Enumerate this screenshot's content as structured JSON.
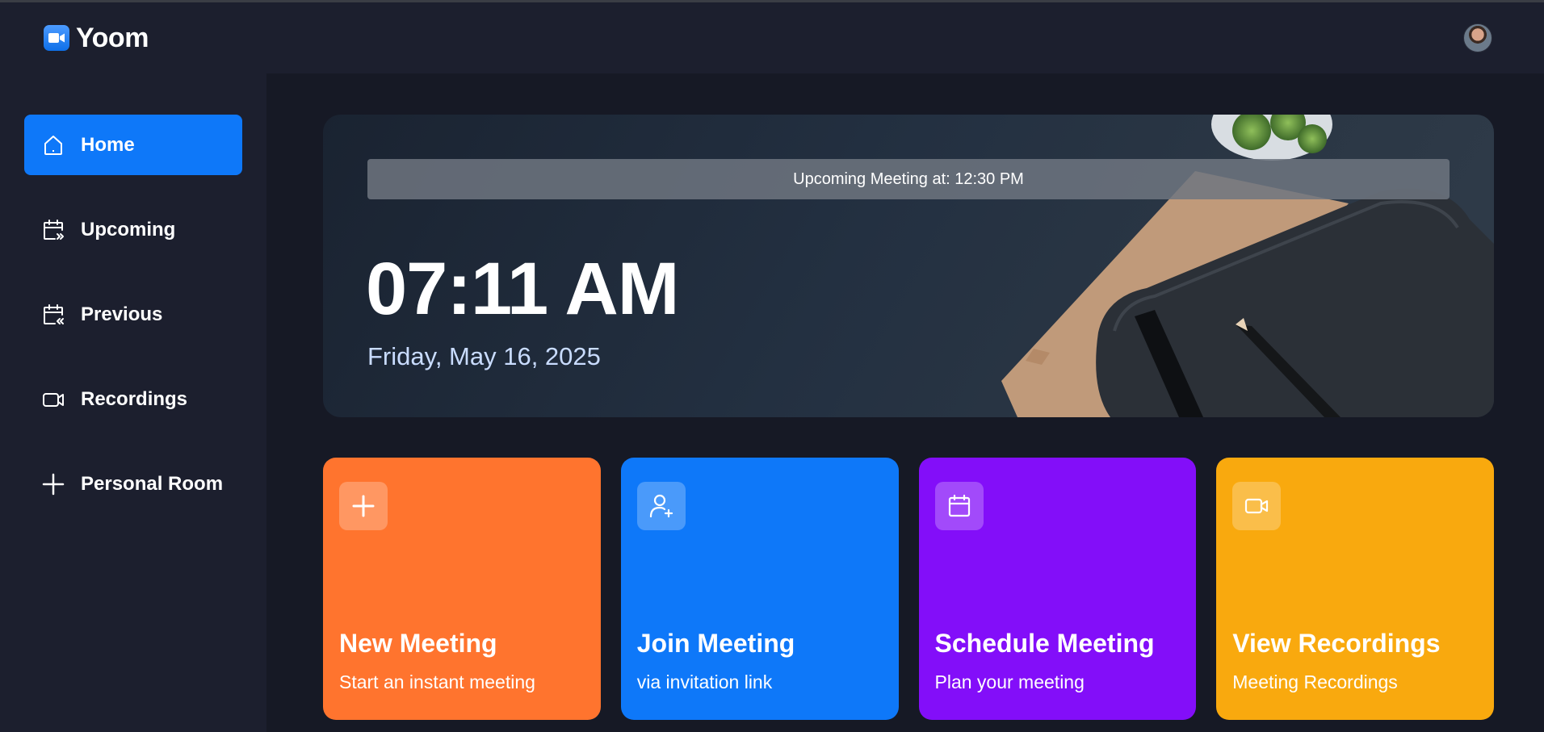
{
  "app": {
    "name": "Yoom",
    "logo_icon": "video-camera-icon",
    "avatar_icon": "user-avatar"
  },
  "sidebar": {
    "items": [
      {
        "label": "Home",
        "icon": "home-icon",
        "active": true
      },
      {
        "label": "Upcoming",
        "icon": "calendar-forward-icon",
        "active": false
      },
      {
        "label": "Previous",
        "icon": "calendar-back-icon",
        "active": false
      },
      {
        "label": "Recordings",
        "icon": "video-icon",
        "active": false
      },
      {
        "label": "Personal Room",
        "icon": "plus-icon",
        "active": false
      }
    ]
  },
  "hero": {
    "upcoming": "Upcoming Meeting at: 12:30 PM",
    "time": "07:11 AM",
    "date": "Friday, May 16, 2025"
  },
  "cards": [
    {
      "title": "New Meeting",
      "subtitle": "Start an instant meeting",
      "icon": "plus-icon",
      "color": "#ff742e"
    },
    {
      "title": "Join Meeting",
      "subtitle": "via invitation link",
      "icon": "user-add-icon",
      "color": "#0e78f9"
    },
    {
      "title": "Schedule Meeting",
      "subtitle": "Plan your meeting",
      "icon": "calendar-icon",
      "color": "#830ef9"
    },
    {
      "title": "View Recordings",
      "subtitle": "Meeting Recordings",
      "icon": "video-icon",
      "color": "#f9a90e"
    }
  ],
  "colors": {
    "background": "#161925",
    "panel": "#1c1f2e",
    "accent": "#0e78f9"
  }
}
